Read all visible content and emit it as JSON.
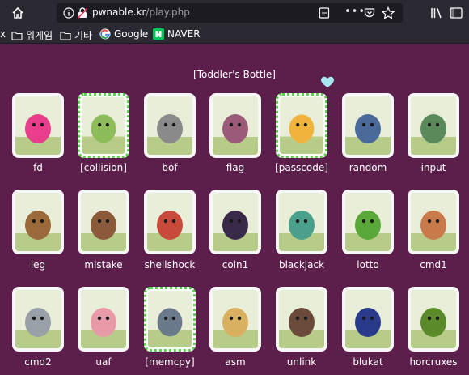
{
  "browser": {
    "url_host": "pwnable.kr",
    "url_path": "/play.php",
    "bookmarks": [
      {
        "label": "워게임",
        "icon": "folder-icon"
      },
      {
        "label": "기타",
        "icon": "folder-icon"
      },
      {
        "label": "Google",
        "icon": "google-icon"
      },
      {
        "label": "NAVER",
        "icon": "naver-icon"
      }
    ],
    "overflow_marker": "x"
  },
  "page": {
    "section_title": "[Toddler's Bottle]",
    "challenges": [
      {
        "label": "fd",
        "solved": false,
        "accent": "#e83e8c"
      },
      {
        "label": "[collision]",
        "solved": true,
        "accent": "#8cbd5a"
      },
      {
        "label": "bof",
        "solved": false,
        "accent": "#8a8a8a"
      },
      {
        "label": "flag",
        "solved": false,
        "accent": "#9a5a78"
      },
      {
        "label": "[passcode]",
        "solved": true,
        "accent": "#f0b43c"
      },
      {
        "label": "random",
        "solved": false,
        "accent": "#4a6a9a"
      },
      {
        "label": "input",
        "solved": false,
        "accent": "#5a8a5a"
      },
      {
        "label": "leg",
        "solved": false,
        "accent": "#9a6a3a"
      },
      {
        "label": "mistake",
        "solved": false,
        "accent": "#8a5a3a"
      },
      {
        "label": "shellshock",
        "solved": false,
        "accent": "#c84a3a"
      },
      {
        "label": "coin1",
        "solved": false,
        "accent": "#3a2a4a"
      },
      {
        "label": "blackjack",
        "solved": false,
        "accent": "#4aa08a"
      },
      {
        "label": "lotto",
        "solved": false,
        "accent": "#5aa83a"
      },
      {
        "label": "cmd1",
        "solved": false,
        "accent": "#c87a4a"
      },
      {
        "label": "cmd2",
        "solved": false,
        "accent": "#9aa0a8"
      },
      {
        "label": "uaf",
        "solved": false,
        "accent": "#e89aa8"
      },
      {
        "label": "[memcpy]",
        "solved": true,
        "accent": "#6a7a8a"
      },
      {
        "label": "asm",
        "solved": false,
        "accent": "#d8b060"
      },
      {
        "label": "unlink",
        "solved": false,
        "accent": "#6a4a3a"
      },
      {
        "label": "blukat",
        "solved": false,
        "accent": "#2a3a8a"
      },
      {
        "label": "horcruxes",
        "solved": false,
        "accent": "#5a8a2a"
      }
    ]
  }
}
